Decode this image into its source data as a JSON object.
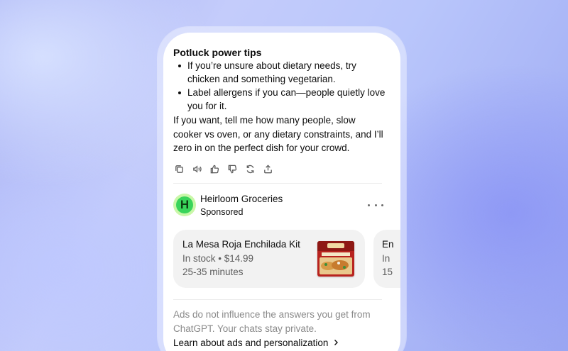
{
  "message": {
    "heading": "Potluck power tips",
    "bullets": [
      "If you’re unsure about dietary needs, try chicken and something vegetarian.",
      "Label allergens if you can—people quietly love you for it."
    ],
    "paragraph": "If you want, tell me how many people, slow cooker vs oven, or any dietary constraints, and I’ll zero in on the perfect dish for your crowd.",
    "actions": [
      "copy-icon",
      "read-aloud-icon",
      "thumbs-up-icon",
      "thumbs-down-icon",
      "regenerate-icon",
      "share-icon"
    ]
  },
  "sponsor": {
    "logo_letter": "H",
    "name": "Heirloom Groceries",
    "label": "Sponsored"
  },
  "products": [
    {
      "title": "La Mesa Roja Enchilada Kit",
      "meta": "In stock • $14.99",
      "time": "25-35 minutes",
      "image": "enchilada-kit-box"
    },
    {
      "title": "En",
      "meta": "In",
      "time": "15"
    }
  ],
  "footer": {
    "disclaimer": "Ads do not influence the answers you get from ChatGPT. Your chats stay private.",
    "link": "Learn about ads and personalization"
  },
  "colors": {
    "logo_outer": "#c9f7a8",
    "logo_inner": "#39d45a",
    "card_bg": "#f2f2f2"
  }
}
